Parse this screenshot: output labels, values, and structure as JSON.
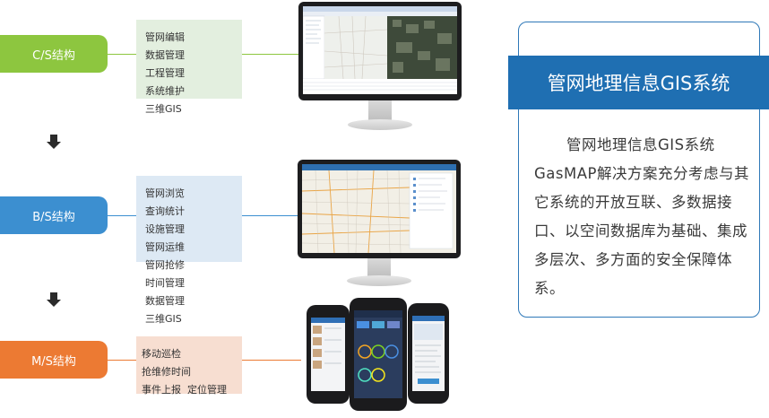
{
  "tiers": [
    {
      "label": "C/S结构",
      "features": [
        "管网编辑",
        "数据管理",
        "工程管理",
        "系统维护",
        "三维GIS"
      ]
    },
    {
      "label": "B/S结构",
      "features": [
        "管网浏览",
        "查询统计",
        "设施管理",
        "管网运维",
        "管网抢修",
        "时间管理",
        "数据管理",
        "三维GIS"
      ]
    },
    {
      "label": "M/S结构",
      "features": [
        "移动巡检",
        "抢维修时间",
        "事件上报",
        "定位管理"
      ]
    }
  ],
  "panel": {
    "title": "管网地理信息GIS系统",
    "description": "管网地理信息GIS系统GasMAP解决方案充分考虑与其它系统的开放互联、多数据接口、以空间数据库为基础、集成多层次、多方面的安全保障体系。"
  },
  "colors": {
    "cs": "#8dc63f",
    "bs": "#3c8fd0",
    "ms": "#ec7a33",
    "panel": "#1f6fb2"
  }
}
